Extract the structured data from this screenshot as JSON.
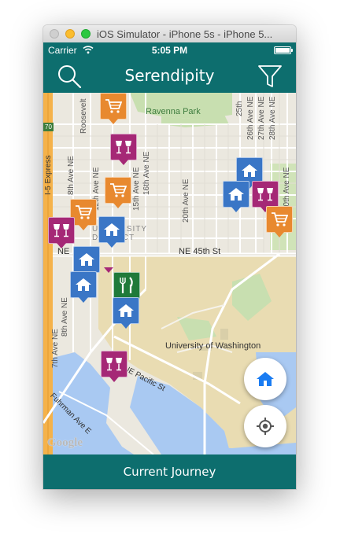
{
  "window": {
    "title": "iOS Simulator - iPhone 5s - iPhone 5..."
  },
  "status_bar": {
    "carrier": "Carrier",
    "time": "5:05 PM",
    "wifi_icon": "wifi-icon",
    "battery_icon": "battery-icon"
  },
  "nav": {
    "title": "Serendipity",
    "left_icon": "search-icon",
    "right_icon": "filter-icon"
  },
  "map": {
    "labels": {
      "ravenna_park": "Ravenna Park",
      "roosevelt": "Roosevelt",
      "ave_8th": "8th Ave NE",
      "ave_8th_b": "8th Ave NE",
      "ave_15th": "15th Ave NE",
      "ave_16th": "16th Ave NE",
      "ave_20th": "20th Ave NE",
      "ave_12th": "12th Ave NE",
      "ave_25th": "25th",
      "ave_26th": "26th Ave NE",
      "ave_27th": "27th Ave NE",
      "ave_28th": "28th Ave NE",
      "ave_30th": "30th Ave NE",
      "ave_7th": "7th Ave NE",
      "ave_8th_c": "8th Ave NE",
      "express": "I-5 Express",
      "ne_45th": "NE 45th St",
      "ne_45th_left": "NE",
      "university_district": "UNIVERSITY DISTRICT",
      "uw": "University of Washington",
      "pacific": "NE Pacific St",
      "fuhrman": "Fuhrman Ave E",
      "highway_sign": "70"
    },
    "google_logo": "Google",
    "pins": [
      {
        "type": "shop",
        "icon": "shopping-cart-icon"
      },
      {
        "type": "bar",
        "icon": "wine-glasses-icon"
      },
      {
        "type": "shop",
        "icon": "shopping-cart-icon"
      },
      {
        "type": "shop",
        "icon": "shopping-cart-icon"
      },
      {
        "type": "bar",
        "icon": "wine-glasses-icon"
      },
      {
        "type": "home",
        "icon": "house-icon"
      },
      {
        "type": "home",
        "icon": "house-icon"
      },
      {
        "type": "home",
        "icon": "house-icon"
      },
      {
        "type": "food",
        "icon": "fork-knife-icon"
      },
      {
        "type": "bar",
        "icon": "wine-glasses-icon"
      },
      {
        "type": "home",
        "icon": "house-icon"
      },
      {
        "type": "home",
        "icon": "house-icon"
      },
      {
        "type": "bar",
        "icon": "wine-glasses-icon"
      },
      {
        "type": "home",
        "icon": "house-icon"
      },
      {
        "type": "shop",
        "icon": "shopping-cart-icon"
      },
      {
        "type": "bar",
        "icon": "wine-glasses-icon"
      }
    ],
    "buttons": {
      "home_icon": "house-icon",
      "locate_icon": "crosshair-icon"
    }
  },
  "bottom_bar": {
    "label": "Current Journey"
  },
  "colors": {
    "teal": "#0d6e6e",
    "shop": "#e8892f",
    "bar": "#a52876",
    "home": "#3a76c6",
    "food": "#1f7a3a",
    "fab_icon": "#1a7cf2"
  }
}
